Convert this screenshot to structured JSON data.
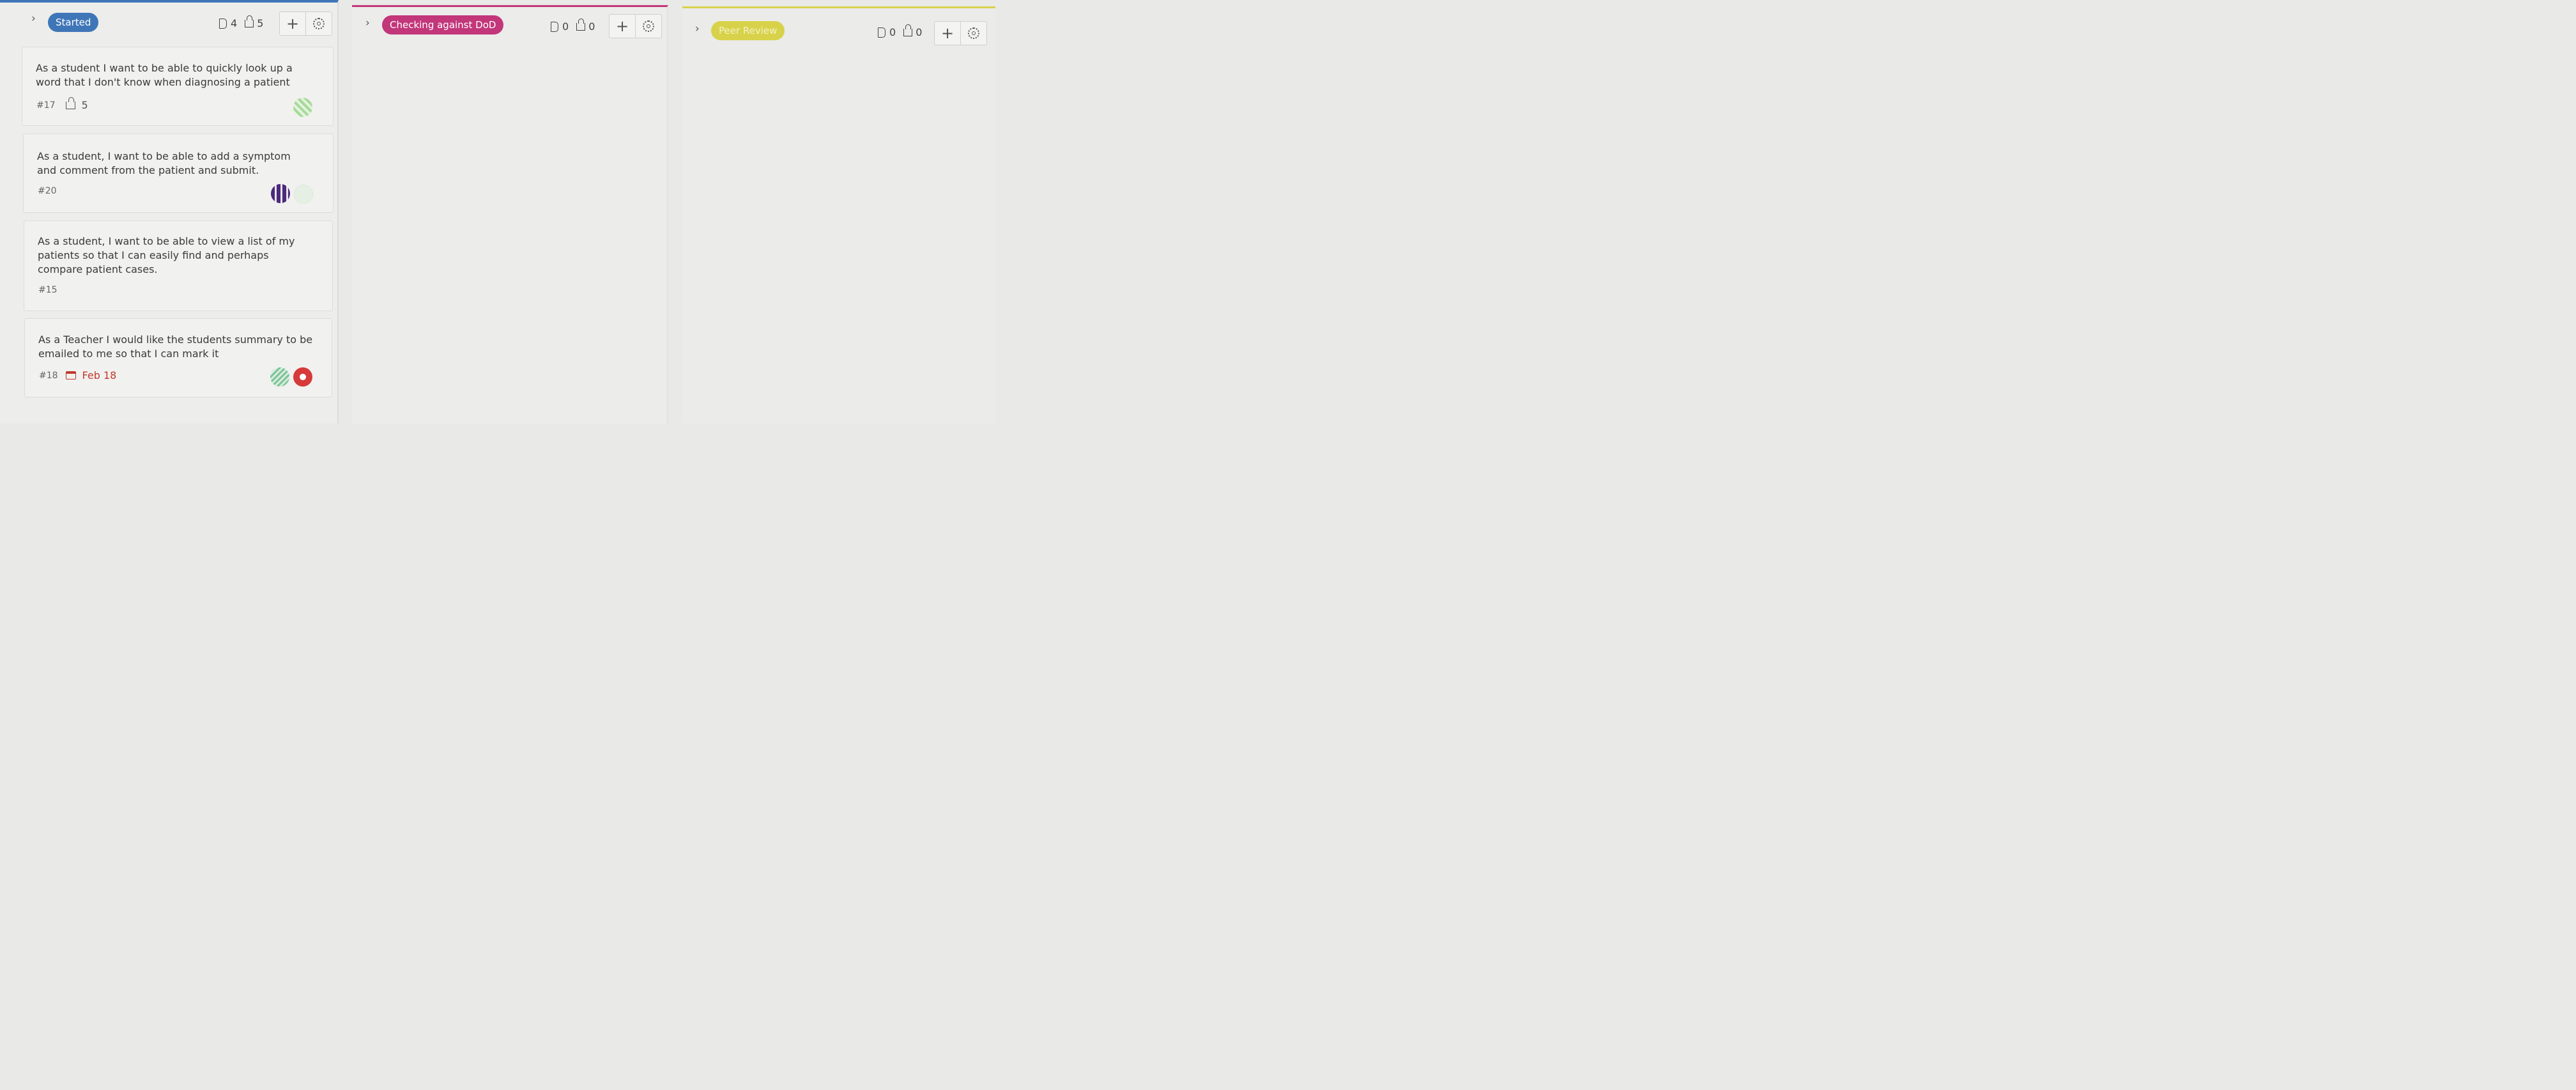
{
  "columns": [
    {
      "status": "Started",
      "color": "#3f76b8",
      "card_count": "4",
      "weight_total": "5",
      "add_label": "+",
      "cards": [
        {
          "title_line1": "As a student I want to be able to quickly look up a",
          "title_line2": "word that I don't know when diagnosing a patient",
          "id": "#17",
          "weight": "5"
        },
        {
          "title_line1": "As a student, I want to be able to add a symptom",
          "title_line2": "and comment from the patient and submit.",
          "id": "#20"
        },
        {
          "title_line1": "As a student, I want to be able to view a list of my",
          "title_line2": "patients so that I can easily find and perhaps",
          "title_line3": "compare patient cases.",
          "id": "#15"
        },
        {
          "title_line1": "As a Teacher I would like the students summary to be",
          "title_line2": "emailed to me so that I can mark it",
          "id": "#18",
          "due": "Feb 18"
        }
      ]
    },
    {
      "status": "Checking against DoD",
      "color": "#c2367a",
      "card_count": "0",
      "weight_total": "0",
      "add_label": "+",
      "cards": []
    },
    {
      "status": "Peer Review",
      "color": "#d8d24a",
      "card_count": "0",
      "weight_total": "0",
      "add_label": "+",
      "cards": []
    }
  ],
  "icons": {
    "chevron": "chevron-right-icon",
    "card_count": "issue-icon",
    "weight": "weight-icon",
    "settings": "gear-icon",
    "due": "calendar-icon"
  }
}
